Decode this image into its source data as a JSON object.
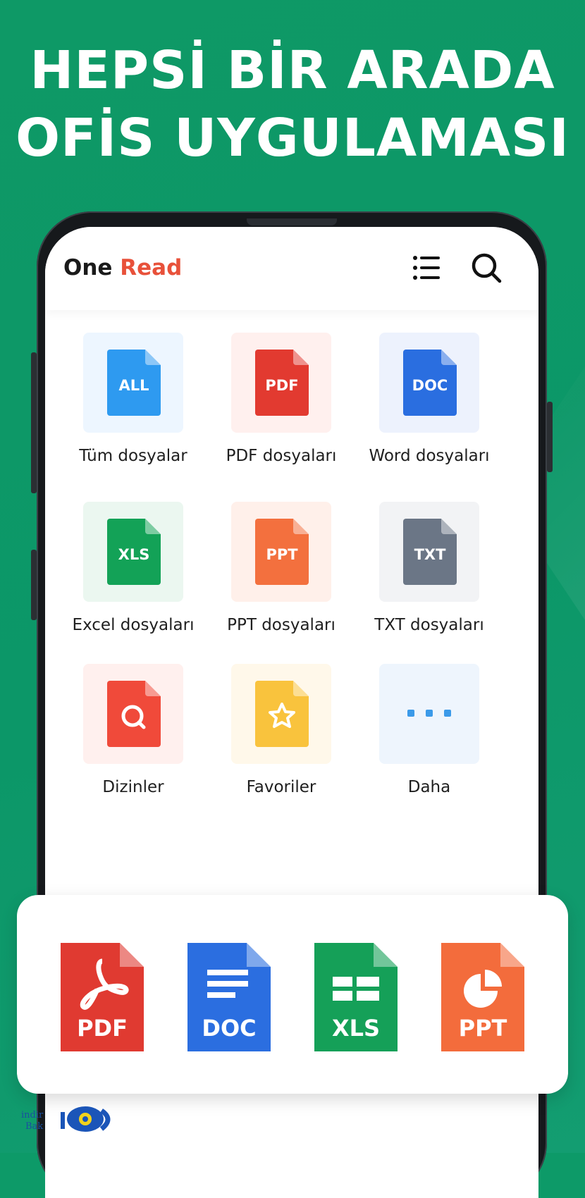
{
  "headline": {
    "line1": "HEPSİ BİR ARADA",
    "line2": "OFİS UYGULAMASI"
  },
  "app": {
    "name_part1": "One",
    "name_part2": "Read"
  },
  "toolbar": {
    "menu_icon": "list-icon",
    "search_icon": "search-icon"
  },
  "categories": [
    {
      "badge": "ALL",
      "label": "Tüm dosyalar",
      "color": "#2e9af0",
      "bg": "#edf6ff"
    },
    {
      "badge": "PDF",
      "label": "PDF dosyaları",
      "color": "#e23a30",
      "bg": "#fff0ee"
    },
    {
      "badge": "DOC",
      "label": "Word dosyaları",
      "color": "#2a6ee0",
      "bg": "#edf2fd"
    },
    {
      "badge": "XLS",
      "label": "Excel dosyaları",
      "color": "#13a257",
      "bg": "#ebf7f0"
    },
    {
      "badge": "PPT",
      "label": "PPT dosyaları",
      "color": "#f3703e",
      "bg": "#fff0ea"
    },
    {
      "badge": "TXT",
      "label": "TXT dosyaları",
      "color": "#6b7686",
      "bg": "#f2f3f5"
    },
    {
      "badge": "",
      "label": "Dizinler",
      "color": "#f04a3a",
      "bg": "#fff0ee",
      "icon": "search-file-icon"
    },
    {
      "badge": "",
      "label": "Favoriler",
      "color": "#f9c33d",
      "bg": "#fff8ea",
      "icon": "star-file-icon"
    },
    {
      "badge": "",
      "label": "Daha",
      "color": "#3b9ae9",
      "bg": "#eef5fd",
      "icon": "more-dots-icon"
    }
  ],
  "formats": [
    {
      "label": "PDF",
      "color": "#e03a31",
      "icon": "pdf-icon"
    },
    {
      "label": "DOC",
      "color": "#2b6ee0",
      "icon": "doc-icon"
    },
    {
      "label": "XLS",
      "color": "#15a058",
      "icon": "xls-icon"
    },
    {
      "label": "PPT",
      "color": "#f36c3c",
      "icon": "ppt-icon"
    }
  ],
  "watermark": {
    "line1": "indir",
    "line2": "Bak",
    "logo_text": "iO"
  }
}
